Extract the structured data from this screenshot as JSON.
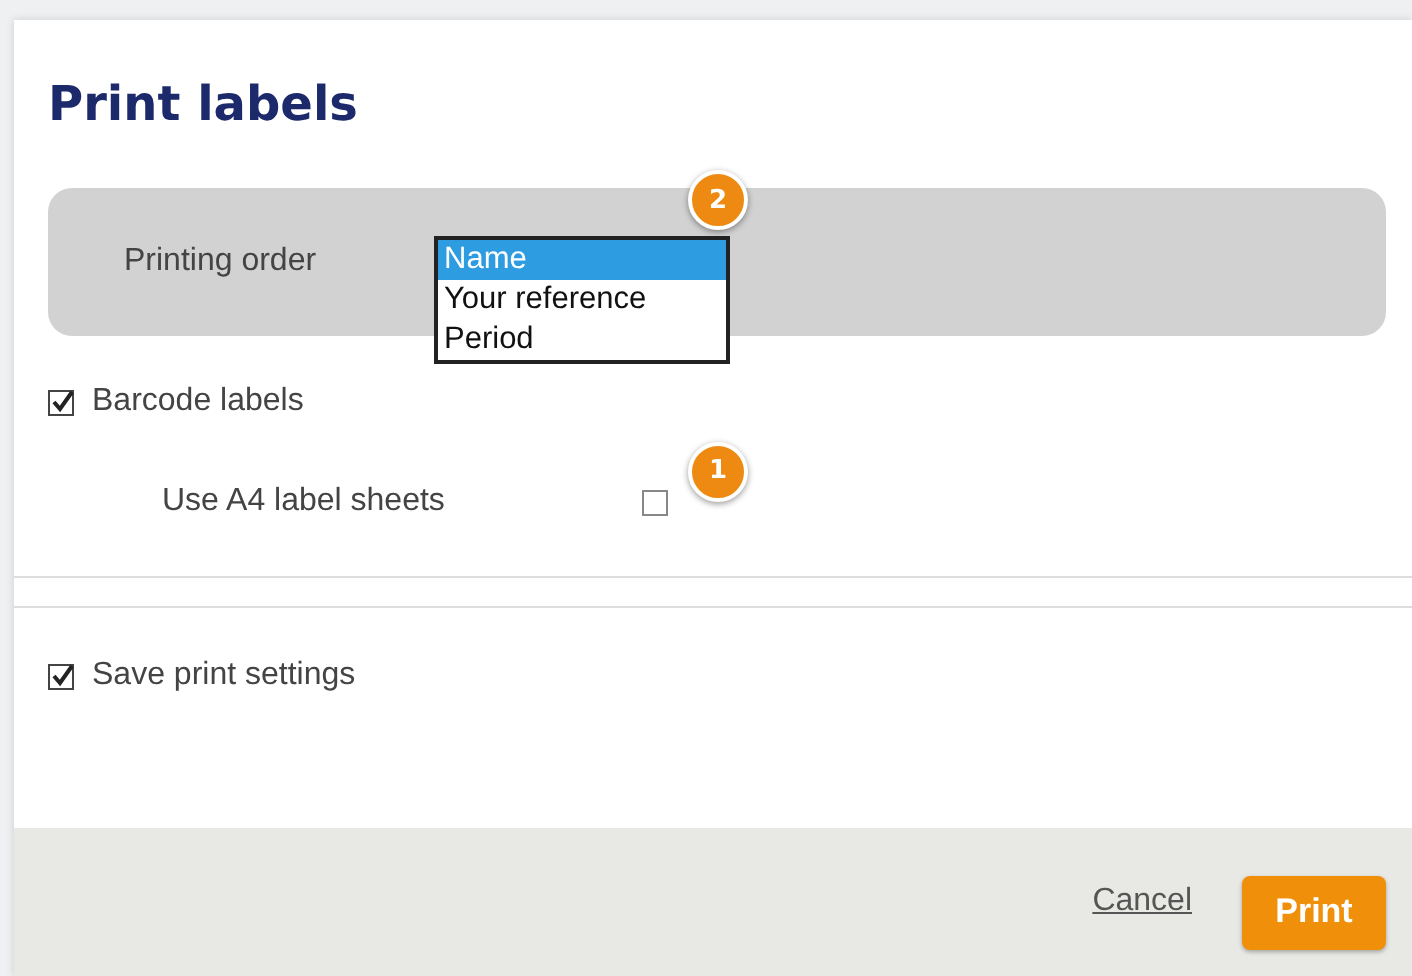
{
  "title": "Print labels",
  "printing_order": {
    "label": "Printing order",
    "callout": "2",
    "options": [
      {
        "label": "Name",
        "selected": true
      },
      {
        "label": "Your reference",
        "selected": false
      },
      {
        "label": "Period",
        "selected": false
      }
    ]
  },
  "options": [
    {
      "kind": "checkbox",
      "label": "Barcode labels",
      "checked": true
    },
    {
      "kind": "sub-checkbox",
      "label": "Use A4 label sheets",
      "checked": false,
      "callout": "1"
    }
  ],
  "save_settings": {
    "label": "Save print settings",
    "checked": true
  },
  "buttons": [
    {
      "kind": "link",
      "label": "Cancel"
    },
    {
      "kind": "primary",
      "label": "Print"
    }
  ]
}
